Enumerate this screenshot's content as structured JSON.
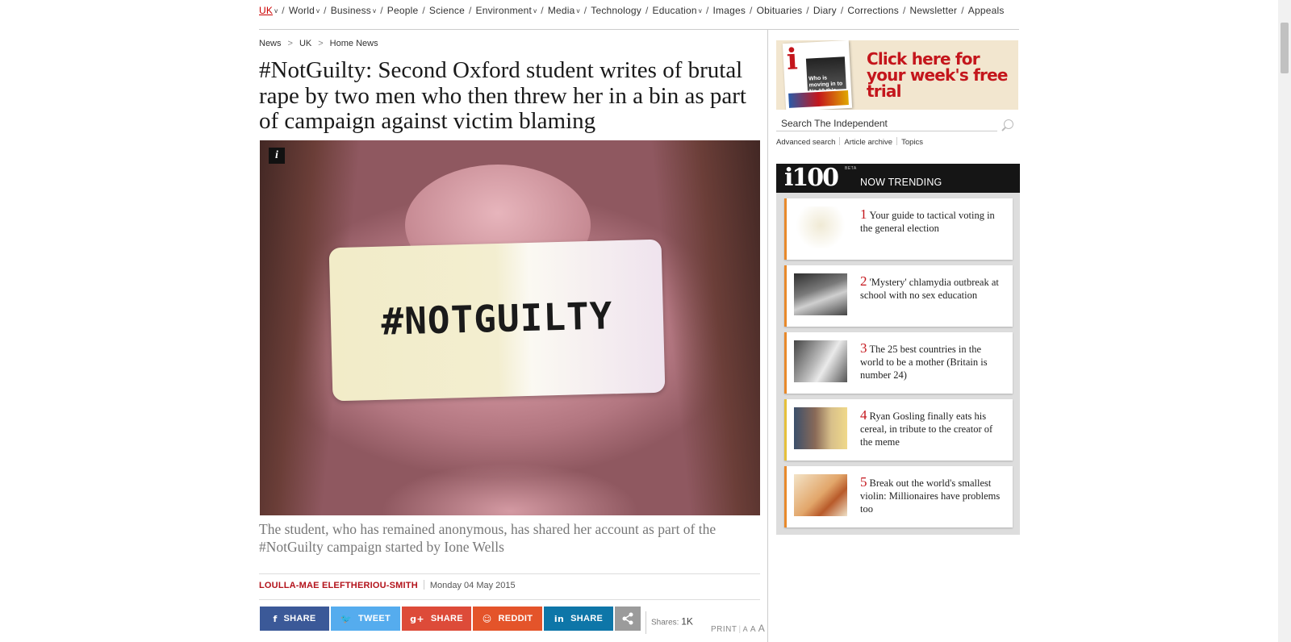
{
  "nav": {
    "items": [
      {
        "label": "UK",
        "dropdown": true,
        "active": true
      },
      {
        "label": "World",
        "dropdown": true
      },
      {
        "label": "Business",
        "dropdown": true
      },
      {
        "label": "People",
        "dropdown": false
      },
      {
        "label": "Science",
        "dropdown": false
      },
      {
        "label": "Environment",
        "dropdown": true
      },
      {
        "label": "Media",
        "dropdown": true
      },
      {
        "label": "Technology",
        "dropdown": false
      },
      {
        "label": "Education",
        "dropdown": true
      },
      {
        "label": "Images",
        "dropdown": false
      },
      {
        "label": "Obituaries",
        "dropdown": false
      },
      {
        "label": "Diary",
        "dropdown": false
      },
      {
        "label": "Corrections",
        "dropdown": false
      },
      {
        "label": "Newsletter",
        "dropdown": false
      },
      {
        "label": "Appeals",
        "dropdown": false
      }
    ]
  },
  "breadcrumb": {
    "items": [
      "News",
      "UK",
      "Home News"
    ]
  },
  "article": {
    "headline": "#NotGuilty: Second Oxford student writes of brutal rape by two men who then threw her in a bin as part of campaign against victim blaming",
    "image_text": "#NOTGUILTY",
    "caption": "The student, who has remained anonymous, has shared her account as part of the #NotGuilty campaign started by Ione Wells",
    "author": "LOULLA-MAE ELEFTHERIOU-SMITH",
    "date": "Monday 04 May 2015"
  },
  "share": {
    "buttons": [
      {
        "label": "SHARE",
        "icon": "f"
      },
      {
        "label": "TWEET",
        "icon": "🐦"
      },
      {
        "label": "SHARE",
        "icon": "g+"
      },
      {
        "label": "REDDIT",
        "icon": "☺"
      },
      {
        "label": "SHARE",
        "icon": "in"
      }
    ],
    "shares_label": "Shares:",
    "shares_count": "1K",
    "print_label": "PRINT",
    "size_a_small": "A",
    "size_a_medium": "A",
    "size_a_large": "A"
  },
  "ad": {
    "masthead": "i",
    "promo": "Who is moving in to No 10 this May?",
    "cta": "Click here for your week's free trial"
  },
  "search": {
    "placeholder": "Search The Independent",
    "links": [
      "Advanced search",
      "Article archive",
      "Topics"
    ]
  },
  "trending": {
    "logo": "i100",
    "beta": "BETA",
    "heading": "NOW TRENDING",
    "items": [
      {
        "num": "1",
        "title": "Your guide to tactical voting in the general election"
      },
      {
        "num": "2",
        "title": "'Mystery' chlamydia outbreak at school with no sex education"
      },
      {
        "num": "3",
        "title": "The 25 best countries in the world to be a mother (Britain is number 24)"
      },
      {
        "num": "4",
        "title": "Ryan Gosling finally eats his cereal, in tribute to the creator of the meme"
      },
      {
        "num": "5",
        "title": "Break out the world's smallest violin: Millionaires have problems too"
      }
    ]
  },
  "colors": {
    "brand_red": "#c4161c",
    "facebook": "#3b5998",
    "twitter": "#55acee",
    "googleplus": "#dd4b39",
    "reddit": "#e4542a",
    "linkedin": "#0e76a8"
  }
}
